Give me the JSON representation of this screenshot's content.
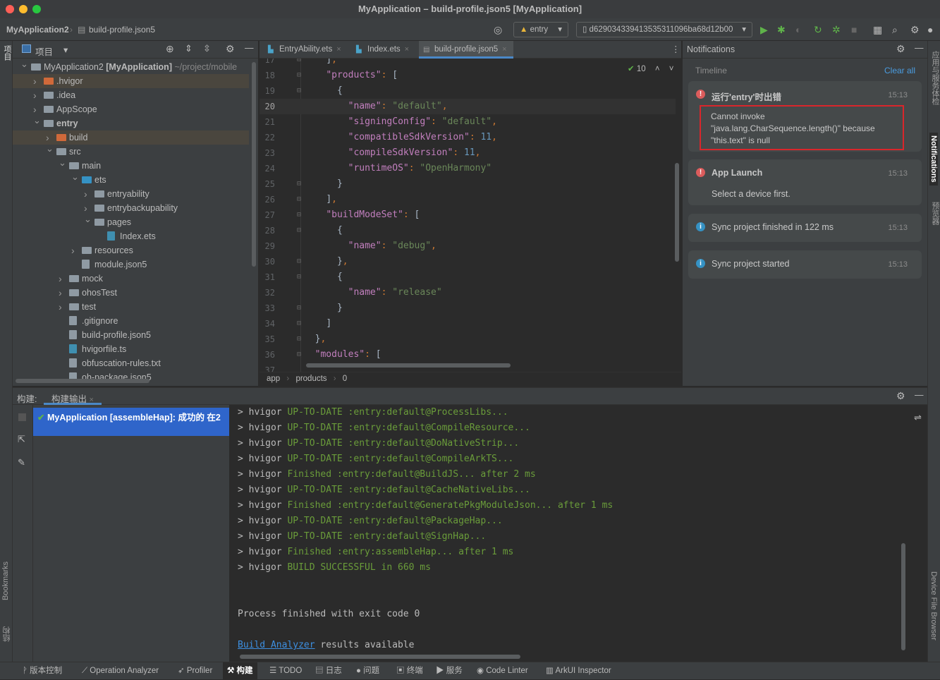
{
  "window": {
    "title": "MyApplication – build-profile.json5 [MyApplication]"
  },
  "navbar": {
    "project": "MyApplication2",
    "file": "build-profile.json5",
    "run_config": "entry",
    "device": "d629034339413535311096ba68d12b00"
  },
  "left_strip": {
    "project": "项目",
    "bookmarks": "Bookmarks",
    "structure": "结构"
  },
  "right_strip": {
    "app_check": "应用与服务体检",
    "notifications": "Notifications",
    "previewer": "预览器",
    "device_file_browser": "Device File Browser"
  },
  "project_panel": {
    "title": "项目",
    "tree": [
      {
        "label": "MyApplication2",
        "bold_suffix": "[MyApplication]",
        "path": "~/project/mobile",
        "depth": 0,
        "arrow": "open",
        "icon": "module"
      },
      {
        "label": ".hvigor",
        "depth": 1,
        "arrow": "closed",
        "icon": "folder-orange",
        "highlight": true
      },
      {
        "label": ".idea",
        "depth": 1,
        "arrow": "closed",
        "icon": "folder"
      },
      {
        "label": "AppScope",
        "depth": 1,
        "arrow": "closed",
        "icon": "folder"
      },
      {
        "label": "entry",
        "depth": 1,
        "arrow": "open",
        "icon": "module",
        "bold": true
      },
      {
        "label": "build",
        "depth": 2,
        "arrow": "closed",
        "icon": "folder-orange",
        "highlight": true
      },
      {
        "label": "src",
        "depth": 2,
        "arrow": "open",
        "icon": "folder"
      },
      {
        "label": "main",
        "depth": 3,
        "arrow": "open",
        "icon": "folder"
      },
      {
        "label": "ets",
        "depth": 4,
        "arrow": "open",
        "icon": "folder-blue"
      },
      {
        "label": "entryability",
        "depth": 5,
        "arrow": "closed",
        "icon": "folder"
      },
      {
        "label": "entrybackupability",
        "depth": 5,
        "arrow": "closed",
        "icon": "folder"
      },
      {
        "label": "pages",
        "depth": 5,
        "arrow": "open",
        "icon": "folder"
      },
      {
        "label": "Index.ets",
        "depth": 6,
        "arrow": "none",
        "icon": "file-ets"
      },
      {
        "label": "resources",
        "depth": 4,
        "arrow": "closed",
        "icon": "folder"
      },
      {
        "label": "module.json5",
        "depth": 4,
        "arrow": "none",
        "icon": "file-json"
      },
      {
        "label": "mock",
        "depth": 3,
        "arrow": "closed",
        "icon": "folder"
      },
      {
        "label": "ohosTest",
        "depth": 3,
        "arrow": "closed",
        "icon": "folder"
      },
      {
        "label": "test",
        "depth": 3,
        "arrow": "closed",
        "icon": "folder"
      },
      {
        "label": ".gitignore",
        "depth": 3,
        "arrow": "none",
        "icon": "file-git"
      },
      {
        "label": "build-profile.json5",
        "depth": 3,
        "arrow": "none",
        "icon": "file-json"
      },
      {
        "label": "hvigorfile.ts",
        "depth": 3,
        "arrow": "none",
        "icon": "file-ts"
      },
      {
        "label": "obfuscation-rules.txt",
        "depth": 3,
        "arrow": "none",
        "icon": "file-txt"
      },
      {
        "label": "oh-package.json5",
        "depth": 3,
        "arrow": "none",
        "icon": "file-json"
      }
    ]
  },
  "editor": {
    "tabs": [
      {
        "label": "EntryAbility.ets",
        "icon": "ets-file-icon"
      },
      {
        "label": "Index.ets",
        "icon": "ets-file-icon"
      },
      {
        "label": "build-profile.json5",
        "icon": "json5-file-icon",
        "active": true
      }
    ],
    "inspection_count": "10",
    "current_line": 20,
    "lines": [
      {
        "n": 17,
        "indent": 4,
        "tokens": [
          [
            "p",
            "]"
          ],
          [
            "c",
            ","
          ]
        ]
      },
      {
        "n": 18,
        "indent": 4,
        "tokens": [
          [
            "k",
            "\"products\""
          ],
          [
            "c",
            ":"
          ],
          [
            "p",
            " ["
          ]
        ]
      },
      {
        "n": 19,
        "indent": 6,
        "tokens": [
          [
            "p",
            "{"
          ]
        ]
      },
      {
        "n": 20,
        "indent": 8,
        "tokens": [
          [
            "k",
            "\"name\""
          ],
          [
            "c",
            ":"
          ],
          [
            "s",
            " \"default\""
          ],
          [
            "c",
            ","
          ]
        ]
      },
      {
        "n": 21,
        "indent": 8,
        "tokens": [
          [
            "k",
            "\"signingConfig\""
          ],
          [
            "c",
            ":"
          ],
          [
            "s",
            " \"default\""
          ],
          [
            "c",
            ","
          ]
        ]
      },
      {
        "n": 22,
        "indent": 8,
        "tokens": [
          [
            "k",
            "\"compatibleSdkVersion\""
          ],
          [
            "c",
            ":"
          ],
          [
            "n",
            " 11"
          ],
          [
            "c",
            ","
          ]
        ]
      },
      {
        "n": 23,
        "indent": 8,
        "tokens": [
          [
            "k",
            "\"compileSdkVersion\""
          ],
          [
            "c",
            ":"
          ],
          [
            "n",
            " 11"
          ],
          [
            "c",
            ","
          ]
        ]
      },
      {
        "n": 24,
        "indent": 8,
        "tokens": [
          [
            "k",
            "\"runtimeOS\""
          ],
          [
            "c",
            ":"
          ],
          [
            "s",
            " \"OpenHarmony\""
          ]
        ]
      },
      {
        "n": 25,
        "indent": 6,
        "tokens": [
          [
            "p",
            "}"
          ]
        ]
      },
      {
        "n": 26,
        "indent": 4,
        "tokens": [
          [
            "p",
            "]"
          ],
          [
            "c",
            ","
          ]
        ]
      },
      {
        "n": 27,
        "indent": 4,
        "tokens": [
          [
            "k",
            "\"buildModeSet\""
          ],
          [
            "c",
            ":"
          ],
          [
            "p",
            " ["
          ]
        ]
      },
      {
        "n": 28,
        "indent": 6,
        "tokens": [
          [
            "p",
            "{"
          ]
        ]
      },
      {
        "n": 29,
        "indent": 8,
        "tokens": [
          [
            "k",
            "\"name\""
          ],
          [
            "c",
            ":"
          ],
          [
            "s",
            " \"debug\""
          ],
          [
            "c",
            ","
          ]
        ]
      },
      {
        "n": 30,
        "indent": 6,
        "tokens": [
          [
            "p",
            "}"
          ],
          [
            "c",
            ","
          ]
        ]
      },
      {
        "n": 31,
        "indent": 6,
        "tokens": [
          [
            "p",
            "{"
          ]
        ]
      },
      {
        "n": 32,
        "indent": 8,
        "tokens": [
          [
            "k",
            "\"name\""
          ],
          [
            "c",
            ":"
          ],
          [
            "s",
            " \"release\""
          ]
        ]
      },
      {
        "n": 33,
        "indent": 6,
        "tokens": [
          [
            "p",
            "}"
          ]
        ]
      },
      {
        "n": 34,
        "indent": 4,
        "tokens": [
          [
            "p",
            "]"
          ]
        ]
      },
      {
        "n": 35,
        "indent": 2,
        "tokens": [
          [
            "p",
            "}"
          ],
          [
            "c",
            ","
          ]
        ]
      },
      {
        "n": 36,
        "indent": 2,
        "tokens": [
          [
            "k",
            "\"modules\""
          ],
          [
            "c",
            ":"
          ],
          [
            "p",
            " ["
          ]
        ]
      },
      {
        "n": 37,
        "indent": 4,
        "tokens": []
      }
    ],
    "breadcrumb": [
      "app",
      "products",
      "0"
    ]
  },
  "notifications": {
    "title": "Notifications",
    "timeline": "Timeline",
    "clear_all": "Clear all",
    "items": [
      {
        "type": "error",
        "title": "运行'entry'时出错",
        "time": "15:13",
        "body": "Cannot invoke \"java.lang.CharSequence.length()\" because \"this.text\" is null",
        "highlighted": true
      },
      {
        "type": "error",
        "title": "App Launch",
        "time": "15:13",
        "body": "Select a device first."
      },
      {
        "type": "info",
        "title": "Sync project finished in 122 ms",
        "time": "15:13"
      },
      {
        "type": "info",
        "title": "Sync project started",
        "time": "15:13"
      }
    ]
  },
  "build_panel": {
    "label": "构建:",
    "tab": "构建输出",
    "tree_item": {
      "name": "MyApplication [assembleHap]:",
      "status": "成功的 在2"
    },
    "lines": [
      {
        "status": "UP-TO-DATE",
        "task": ":entry:default@ProcessLibs..."
      },
      {
        "status": "UP-TO-DATE",
        "task": ":entry:default@CompileResource..."
      },
      {
        "status": "UP-TO-DATE",
        "task": ":entry:default@DoNativeStrip..."
      },
      {
        "status": "UP-TO-DATE",
        "task": ":entry:default@CompileArkTS..."
      },
      {
        "status": "Finished",
        "task": ":entry:default@BuildJS... after 2 ms"
      },
      {
        "status": "UP-TO-DATE",
        "task": ":entry:default@CacheNativeLibs..."
      },
      {
        "status": "Finished",
        "task": ":entry:default@GeneratePkgModuleJson... after 1 ms"
      },
      {
        "status": "UP-TO-DATE",
        "task": ":entry:default@PackageHap..."
      },
      {
        "status": "UP-TO-DATE",
        "task": ":entry:default@SignHap..."
      },
      {
        "status": "Finished",
        "task": ":entry:assembleHap... after 1 ms"
      },
      {
        "status": "BUILD SUCCESSFUL",
        "task": "in 660 ms"
      }
    ],
    "prefix": "> hvigor ",
    "exit": "Process finished with exit code 0",
    "analyzer_link": "Build Analyzer",
    "analyzer_suffix": " results available"
  },
  "statusbar": {
    "items": [
      {
        "label": "版本控制",
        "icon": "vcs-icon"
      },
      {
        "label": "Operation Analyzer",
        "icon": "chart-icon"
      },
      {
        "label": "Profiler",
        "icon": "profiler-icon"
      },
      {
        "label": "构建",
        "icon": "hammer-icon",
        "active": true
      },
      {
        "label": "TODO",
        "icon": "list-icon"
      },
      {
        "label": "日志",
        "icon": "log-icon"
      },
      {
        "label": "问题",
        "icon": "problems-icon"
      },
      {
        "label": "终端",
        "icon": "terminal-icon"
      },
      {
        "label": "服务",
        "icon": "services-icon"
      },
      {
        "label": "Code Linter",
        "icon": "linter-icon"
      },
      {
        "label": "ArkUI Inspector",
        "icon": "inspector-icon"
      }
    ]
  },
  "colors": {
    "accent": "#4a88c7",
    "error": "#db5c5c",
    "info": "#3592c4",
    "success": "#5fb34a",
    "highlight_border": "#d9262b"
  }
}
